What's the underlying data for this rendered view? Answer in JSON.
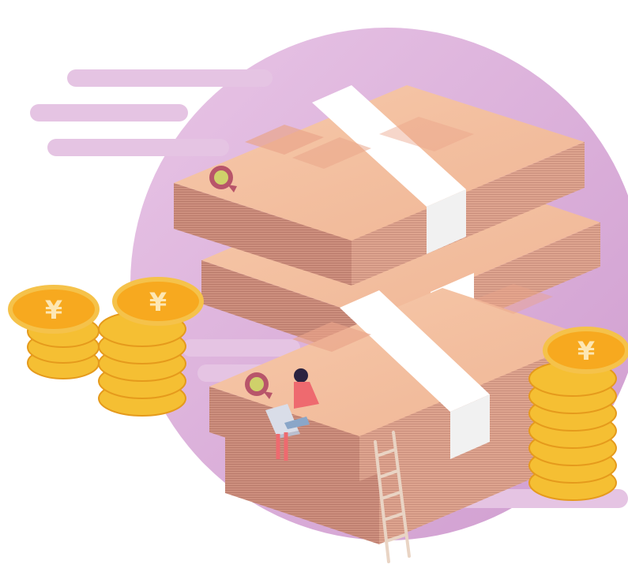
{
  "illustration": {
    "coin_symbol": "¥",
    "colors": {
      "background": "#ffffff",
      "circle": "#dcb3da",
      "stripe": "#e6c6e4",
      "note_top": "#f1bfa2",
      "note_side_left": "#c98c7c",
      "note_side_right": "#d89b86",
      "band": "#ffffff",
      "coin_face": "#f7a91f",
      "coin_edge": "#f5bf33",
      "person_shirt": "#ee6a6f"
    }
  }
}
